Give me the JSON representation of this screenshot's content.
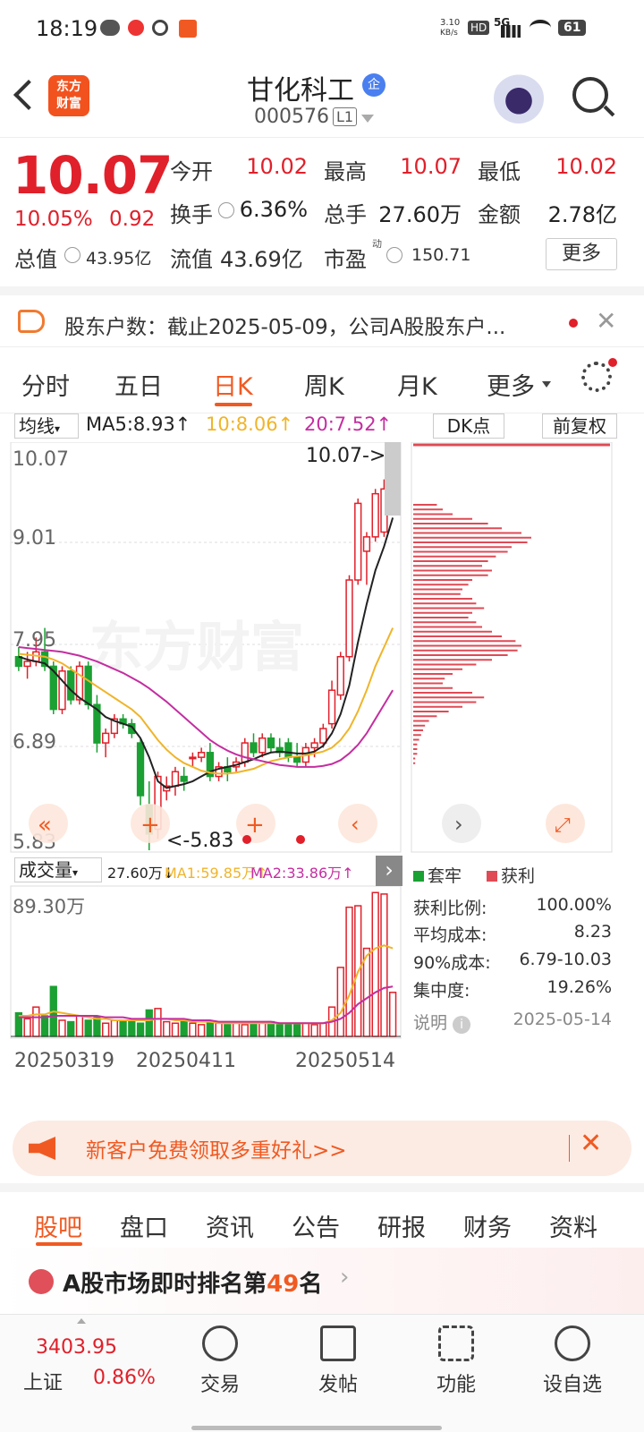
{
  "status": {
    "time": "18:19",
    "net_speed_top": "3.10",
    "net_speed_unit": "KB/s",
    "hd": "HD",
    "signal": "5G",
    "battery": "61"
  },
  "header": {
    "logo_line1": "东方",
    "logo_line2": "财富",
    "name": "甘化科工",
    "badge": "企",
    "code": "000576",
    "level": "L1"
  },
  "quote": {
    "price": "10.07",
    "pct": "10.05%",
    "change": "0.92",
    "open_label": "今开",
    "open": "10.02",
    "high_label": "最高",
    "high": "10.07",
    "low_label": "最低",
    "low": "10.02",
    "turnover_label": "换手",
    "turnover": "6.36%",
    "volume_label": "总手",
    "volume": "27.60万",
    "amount_label": "金额",
    "amount": "2.78亿",
    "mcap_label": "总值",
    "mcap": "43.95亿",
    "float_label": "流值",
    "float": "43.69亿",
    "pe_label": "市盈",
    "pe_sup": "动",
    "pe": "150.71",
    "more": "更多"
  },
  "notice": {
    "text": "股东户数：截止2025-05-09，公司A股股东户..."
  },
  "ktabs": [
    "分时",
    "五日",
    "日K",
    "周K",
    "月K",
    "更多"
  ],
  "kline": {
    "ma_selector": "均线",
    "ma5": "MA5:8.93↑",
    "ma10": "10:8.06↑",
    "ma20": "20:7.52↑",
    "dk": "DK点",
    "adjust": "前复权",
    "y_labels": [
      "10.07",
      "9.01",
      "7.95",
      "6.89",
      "5.83"
    ],
    "max_tag": "10.07->",
    "min_tag": "<-5.83",
    "watermark": "东方财富"
  },
  "volume": {
    "selector": "成交量",
    "vol": "27.60万↓",
    "ma1": "MA1:59.85万↑",
    "ma2": "MA2:33.86万↑",
    "max_label": "89.30万",
    "dates": [
      "20250319",
      "20250411",
      "20250514"
    ]
  },
  "chips": {
    "legend_trap": "套牢",
    "legend_profit": "获利",
    "rows": [
      {
        "label": "获利比例:",
        "value": "100.00%"
      },
      {
        "label": "平均成本:",
        "value": "8.23"
      },
      {
        "label": "90%成本:",
        "value": "6.79-10.03"
      },
      {
        "label": "集中度:",
        "value": "19.26%"
      }
    ],
    "note": "说明",
    "date": "2025-05-14"
  },
  "promo": {
    "text": "新客户免费领取多重好礼>>"
  },
  "subtabs": [
    "股吧",
    "盘口",
    "资讯",
    "公告",
    "研报",
    "财务",
    "资料"
  ],
  "rank": {
    "prefix": "A股市场即时排名第",
    "num": "49",
    "suffix": "名"
  },
  "bottom": {
    "index_value": "3403.95",
    "index_name": "上证",
    "index_pct": "0.86%",
    "items": [
      "交易",
      "发帖",
      "功能",
      "设自选"
    ]
  },
  "colors": {
    "up": "#e0202a",
    "down": "#1aa033",
    "ma5": "#222222",
    "ma10": "#f0b429",
    "ma20": "#c42ea0"
  },
  "chart_data": {
    "type": "candlestick",
    "title": "",
    "ylim": [
      5.83,
      10.07
    ],
    "candles": [
      [
        7.85,
        7.95,
        7.7,
        7.75
      ],
      [
        7.75,
        7.9,
        7.62,
        7.8
      ],
      [
        7.8,
        8.05,
        7.75,
        7.9
      ],
      [
        7.9,
        8.15,
        7.7,
        7.75
      ],
      [
        7.75,
        7.8,
        7.25,
        7.3
      ],
      [
        7.3,
        7.75,
        7.25,
        7.7
      ],
      [
        7.7,
        7.75,
        7.35,
        7.4
      ],
      [
        7.4,
        7.8,
        7.35,
        7.75
      ],
      [
        7.75,
        7.8,
        7.3,
        7.35
      ],
      [
        7.35,
        7.45,
        6.85,
        6.95
      ],
      [
        6.95,
        7.1,
        6.8,
        7.05
      ],
      [
        7.05,
        7.25,
        7.0,
        7.2
      ],
      [
        7.2,
        7.25,
        7.1,
        7.15
      ],
      [
        7.15,
        7.2,
        7.0,
        7.05
      ],
      [
        6.95,
        7.0,
        6.3,
        6.4
      ],
      [
        6.3,
        6.55,
        5.83,
        6.0
      ],
      [
        6.05,
        6.65,
        5.95,
        6.6
      ],
      [
        6.45,
        6.6,
        6.35,
        6.5
      ],
      [
        6.5,
        6.7,
        6.4,
        6.65
      ],
      [
        6.6,
        6.7,
        6.45,
        6.55
      ],
      [
        6.8,
        6.85,
        6.7,
        6.8
      ],
      [
        6.8,
        6.9,
        6.75,
        6.85
      ],
      [
        6.85,
        6.95,
        6.55,
        6.6
      ],
      [
        6.6,
        6.75,
        6.55,
        6.7
      ],
      [
        6.7,
        6.8,
        6.55,
        6.65
      ],
      [
        6.7,
        6.8,
        6.65,
        6.75
      ],
      [
        6.75,
        7.0,
        6.7,
        6.95
      ],
      [
        6.95,
        7.05,
        6.8,
        6.85
      ],
      [
        6.85,
        7.05,
        6.8,
        7.0
      ],
      [
        7.0,
        7.05,
        6.85,
        6.9
      ],
      [
        6.9,
        7.0,
        6.8,
        6.85
      ],
      [
        6.95,
        7.0,
        6.75,
        6.8
      ],
      [
        6.8,
        6.95,
        6.7,
        6.75
      ],
      [
        6.75,
        6.95,
        6.7,
        6.9
      ],
      [
        6.9,
        7.0,
        6.8,
        6.95
      ],
      [
        6.95,
        7.15,
        6.9,
        7.1
      ],
      [
        7.15,
        7.6,
        7.1,
        7.5
      ],
      [
        7.45,
        7.9,
        7.4,
        7.85
      ],
      [
        7.85,
        8.7,
        7.8,
        8.65
      ],
      [
        8.65,
        9.5,
        8.6,
        9.45
      ],
      [
        8.95,
        9.15,
        8.6,
        9.1
      ],
      [
        9.1,
        9.6,
        9.05,
        9.55
      ],
      [
        9.15,
        9.7,
        9.1,
        9.6
      ],
      [
        10.02,
        10.07,
        10.02,
        10.07
      ]
    ],
    "ma5": [
      7.85,
      7.82,
      7.8,
      7.78,
      7.7,
      7.6,
      7.5,
      7.42,
      7.36,
      7.3,
      7.22,
      7.18,
      7.15,
      7.12,
      7.0,
      6.8,
      6.55,
      6.48,
      6.5,
      6.52,
      6.55,
      6.6,
      6.65,
      6.68,
      6.7,
      6.72,
      6.75,
      6.78,
      6.82,
      6.85,
      6.86,
      6.85,
      6.84,
      6.84,
      6.86,
      6.92,
      7.05,
      7.25,
      7.55,
      8.0,
      8.4,
      8.75,
      9.0,
      9.3
    ],
    "ma10": [
      7.88,
      7.87,
      7.86,
      7.85,
      7.82,
      7.78,
      7.72,
      7.66,
      7.6,
      7.54,
      7.48,
      7.42,
      7.36,
      7.3,
      7.22,
      7.1,
      6.98,
      6.88,
      6.8,
      6.74,
      6.7,
      6.66,
      6.64,
      6.63,
      6.63,
      6.64,
      6.66,
      6.68,
      6.72,
      6.76,
      6.78,
      6.8,
      6.81,
      6.82,
      6.84,
      6.86,
      6.9,
      6.98,
      7.1,
      7.28,
      7.5,
      7.75,
      7.95,
      8.15
    ],
    "ma20": [
      7.95,
      7.94,
      7.93,
      7.92,
      7.91,
      7.9,
      7.88,
      7.86,
      7.83,
      7.8,
      7.76,
      7.72,
      7.68,
      7.63,
      7.58,
      7.52,
      7.45,
      7.38,
      7.3,
      7.22,
      7.14,
      7.06,
      6.98,
      6.92,
      6.87,
      6.83,
      6.8,
      6.78,
      6.76,
      6.74,
      6.72,
      6.71,
      6.7,
      6.7,
      6.7,
      6.71,
      6.73,
      6.77,
      6.84,
      6.93,
      7.05,
      7.2,
      7.35,
      7.5
    ],
    "volumes": [
      16,
      12,
      20,
      14,
      34,
      11,
      10,
      14,
      11,
      13,
      9,
      11,
      10,
      11,
      9,
      18,
      19,
      10,
      9,
      10,
      9,
      8,
      10,
      9,
      8,
      9,
      8,
      9,
      9,
      10,
      8,
      8,
      8,
      9,
      8,
      9,
      20,
      47,
      88,
      89,
      60,
      98,
      97,
      30
    ],
    "vol_ma1": [
      14,
      14,
      15,
      15,
      17,
      16,
      15,
      14,
      13,
      12,
      12,
      11,
      11,
      11,
      11,
      11,
      12,
      12,
      11,
      11,
      10,
      10,
      10,
      9,
      9,
      9,
      9,
      9,
      9,
      9,
      9,
      9,
      9,
      9,
      9,
      9,
      11,
      16,
      28,
      44,
      55,
      60,
      62,
      60
    ],
    "vol_ma2": [
      13,
      13,
      13,
      13,
      14,
      14,
      14,
      14,
      14,
      14,
      13,
      13,
      13,
      12,
      12,
      12,
      12,
      12,
      12,
      12,
      11,
      11,
      11,
      10,
      10,
      10,
      10,
      10,
      10,
      10,
      9,
      9,
      9,
      9,
      9,
      9,
      10,
      12,
      16,
      22,
      26,
      30,
      33,
      34
    ],
    "chip_profile": [
      0.12,
      0.15,
      0.2,
      0.3,
      0.38,
      0.45,
      0.55,
      0.6,
      0.58,
      0.5,
      0.48,
      0.42,
      0.38,
      0.35,
      0.4,
      0.38,
      0.3,
      0.28,
      0.25,
      0.24,
      0.3,
      0.32,
      0.36,
      0.3,
      0.28,
      0.32,
      0.35,
      0.4,
      0.45,
      0.52,
      0.55,
      0.53,
      0.48,
      0.4,
      0.32,
      0.25,
      0.2,
      0.16,
      0.15,
      0.2,
      0.3,
      0.36,
      0.32,
      0.25,
      0.18,
      0.12,
      0.08,
      0.06,
      0.05,
      0.04,
      0.03,
      0.02,
      0.02,
      0.02,
      0.01,
      0.01
    ]
  }
}
